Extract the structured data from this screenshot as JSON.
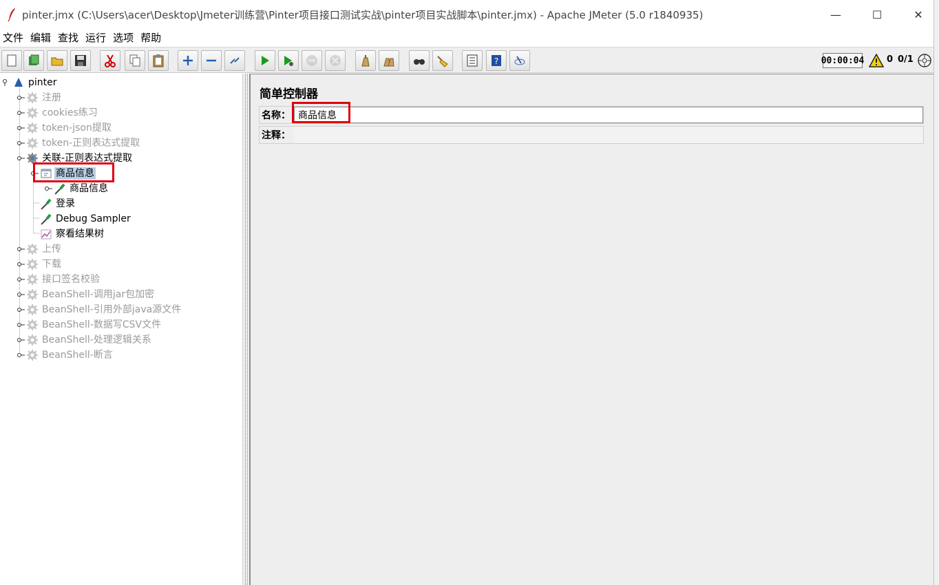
{
  "window": {
    "title": "pinter.jmx (C:\\Users\\acer\\Desktop\\Jmeter训练营\\Pinter项目接口测试实战\\pinter项目实战脚本\\pinter.jmx) - Apache JMeter (5.0 r1840935)",
    "minimize": "—",
    "maximize": "☐",
    "close": "✕"
  },
  "menu": [
    "文件",
    "编辑",
    "查找",
    "运行",
    "选项",
    "帮助"
  ],
  "toolbar": {
    "buttons": [
      {
        "icon": "new-icon"
      },
      {
        "icon": "templates-icon"
      },
      {
        "icon": "open-icon"
      },
      {
        "icon": "save-icon"
      },
      {
        "icon": "cut-icon"
      },
      {
        "icon": "copy-icon"
      },
      {
        "icon": "paste-icon"
      },
      {
        "icon": "expand-icon"
      },
      {
        "icon": "collapse-icon"
      },
      {
        "icon": "toggle-icon"
      },
      {
        "icon": "start-icon"
      },
      {
        "icon": "start-no-pause-icon"
      },
      {
        "icon": "stop-icon"
      },
      {
        "icon": "shutdown-icon"
      },
      {
        "icon": "clear-icon"
      },
      {
        "icon": "clear-all-icon"
      },
      {
        "icon": "search-icon"
      },
      {
        "icon": "reset-search-icon"
      },
      {
        "icon": "function-helper-icon"
      },
      {
        "icon": "help-icon"
      },
      {
        "icon": "remote-icon"
      }
    ],
    "timer": "00:00:04",
    "error_count": "0",
    "thread_count": "0/1"
  },
  "tree": {
    "root": "pinter",
    "items": [
      {
        "label": "注册",
        "disabled": true
      },
      {
        "label": "cookies练习",
        "disabled": true
      },
      {
        "label": "token-json提取",
        "disabled": true
      },
      {
        "label": "token-正则表达式提取",
        "disabled": true
      },
      {
        "label": "关联-正则表达式提取",
        "disabled": false
      },
      {
        "label": "商品信息",
        "selected": true
      },
      {
        "label": "商品信息"
      },
      {
        "label": "登录"
      },
      {
        "label": "Debug Sampler"
      },
      {
        "label": "察看结果树"
      },
      {
        "label": "上传",
        "disabled": true
      },
      {
        "label": "下载",
        "disabled": true
      },
      {
        "label": "接口签名校验",
        "disabled": true
      },
      {
        "label": "BeanShell-调用jar包加密",
        "disabled": true
      },
      {
        "label": "BeanShell-引用外部java源文件",
        "disabled": true
      },
      {
        "label": "BeanShell-数据写CSV文件",
        "disabled": true
      },
      {
        "label": "BeanShell-处理逻辑关系",
        "disabled": true
      },
      {
        "label": "BeanShell-断言",
        "disabled": true
      }
    ]
  },
  "panel": {
    "title": "简单控制器",
    "name_label": "名称：",
    "name_value": "商品信息",
    "comment_label": "注释：",
    "comment_value": ""
  },
  "colors": {
    "highlight": "#e0000e",
    "selection": "#b8cfe5",
    "disabled_text": "#9a9a9a"
  }
}
